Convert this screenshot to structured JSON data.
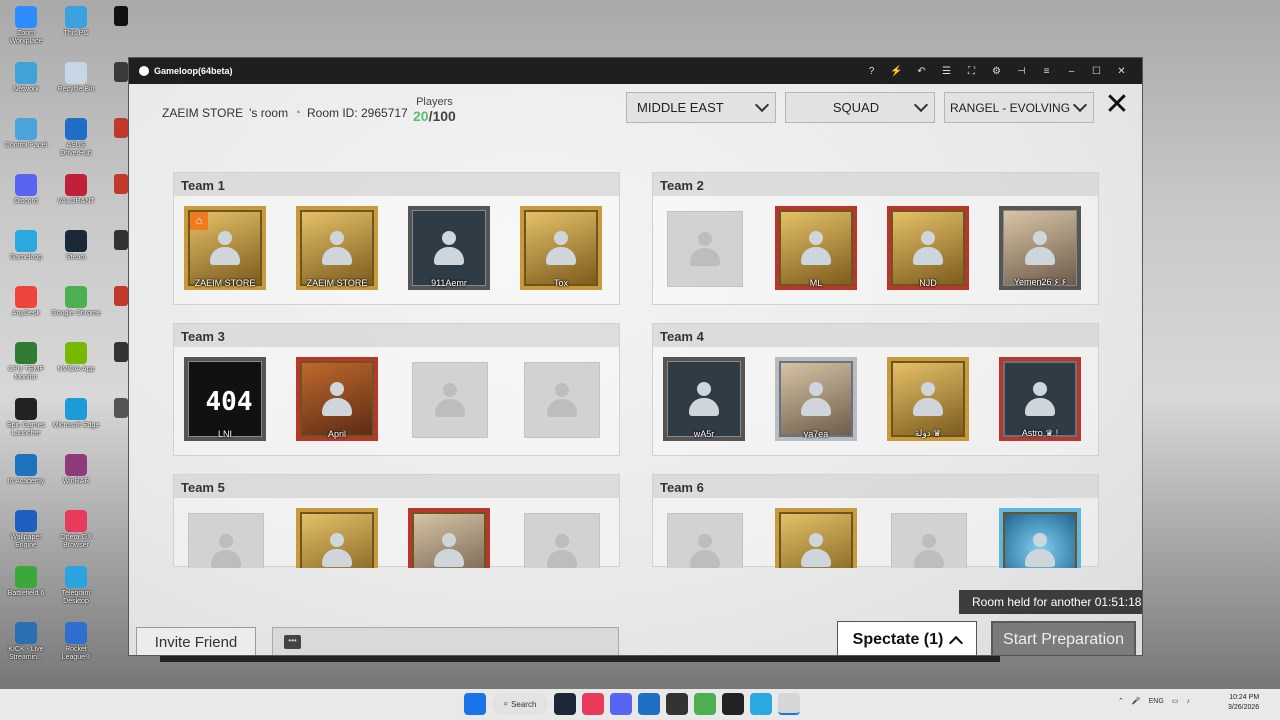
{
  "desktop": {
    "icons": [
      {
        "label": "Zoom Workplace",
        "color": "#2d8cff"
      },
      {
        "label": "This PC",
        "color": "#3aa0e0"
      },
      {
        "label": "Network",
        "color": "#3fa3d8"
      },
      {
        "label": "Recycle Bin",
        "color": "#c6d6e4"
      },
      {
        "label": "Control Panel",
        "color": "#4aa3db"
      },
      {
        "label": "ASUS DriverHub",
        "color": "#1f6fc6"
      },
      {
        "label": "Discord",
        "color": "#5865f2"
      },
      {
        "label": "VALORANT",
        "color": "#c0203a"
      },
      {
        "label": "Gameloop",
        "color": "#29a9e0"
      },
      {
        "label": "Steam",
        "color": "#1b2838"
      },
      {
        "label": "AnyDesk",
        "color": "#ef443b"
      },
      {
        "label": "Google Chrome",
        "color": "#4caf50"
      },
      {
        "label": "CPU TEMP Monitor",
        "color": "#2f7d32"
      },
      {
        "label": "NVIDIA App",
        "color": "#76b900"
      },
      {
        "label": "Epic Games Launcher",
        "color": "#222222"
      },
      {
        "label": "Microsoft Edge",
        "color": "#1d9bd8"
      },
      {
        "label": "Io Academy",
        "color": "#1e73be"
      },
      {
        "label": "WinRAR",
        "color": "#8e3b7c"
      },
      {
        "label": "Wallpaper Engine",
        "color": "#1f5fbf"
      },
      {
        "label": "Opera GX Browser",
        "color": "#e83a5b"
      },
      {
        "label": "Battlefield 6",
        "color": "#3ba83b"
      },
      {
        "label": "Telegram Desktop",
        "color": "#2aa3e0"
      },
      {
        "label": "KICK - Live Streamin...",
        "color": "#2b6fb5"
      },
      {
        "label": "Rocket League®",
        "color": "#2f6fd1"
      }
    ]
  },
  "window": {
    "title": "Gameloop(64beta)",
    "controls": [
      "?",
      "⚡",
      "↶",
      "☰",
      "⛶",
      "⚙",
      "⊣",
      "≡",
      "–",
      "☐",
      "✕"
    ]
  },
  "room": {
    "owner": "ZAEIM STORE",
    "owner_suffix": "'s room",
    "room_id": "Room ID: 2965717",
    "players_label": "Players",
    "players_current": "20",
    "players_max": "/100"
  },
  "filters": {
    "region": "MIDDLE EAST",
    "mode": "SQUAD",
    "map": "RANGEL - EVOLVING"
  },
  "teams": [
    {
      "name": "Team 1",
      "slots": [
        {
          "filled": true,
          "player": "ZAEIM STORE",
          "style": "gold",
          "home": true
        },
        {
          "filled": true,
          "player": "ZAEIM STORE",
          "style": "gold"
        },
        {
          "filled": true,
          "player": "911Aemr",
          "style": "plain"
        },
        {
          "filled": true,
          "player": "Tox",
          "style": "gold photo"
        }
      ]
    },
    {
      "name": "Team 2",
      "slots": [
        {
          "filled": false
        },
        {
          "filled": true,
          "player": "ML",
          "style": "gold red"
        },
        {
          "filled": true,
          "player": "NJD",
          "style": "gold red"
        },
        {
          "filled": true,
          "player": "Yemen26 ۶ ۶",
          "style": "plain photo"
        }
      ]
    },
    {
      "name": "Team 3",
      "slots": [
        {
          "filled": true,
          "player": "LNI",
          "style": "plain dark",
          "big": "404"
        },
        {
          "filled": true,
          "player": "April",
          "style": "red orange"
        },
        {
          "filled": false
        },
        {
          "filled": false
        }
      ]
    },
    {
      "name": "Team 4",
      "slots": [
        {
          "filled": true,
          "player": "wA5r",
          "style": "plain"
        },
        {
          "filled": true,
          "player": "ya7ea",
          "style": "silver photo"
        },
        {
          "filled": true,
          "player": "دولة ♛",
          "style": "gold photo"
        },
        {
          "filled": true,
          "player": "Astro ♛ !",
          "style": "silver red"
        }
      ]
    },
    {
      "name": "Team 5",
      "slots": [
        {
          "filled": false
        },
        {
          "filled": true,
          "player": "",
          "style": "gold"
        },
        {
          "filled": true,
          "player": "",
          "style": "red photo"
        },
        {
          "filled": false
        }
      ]
    },
    {
      "name": "Team 6",
      "slots": [
        {
          "filled": false
        },
        {
          "filled": true,
          "player": "",
          "style": "gold gold"
        },
        {
          "filled": false
        },
        {
          "filled": true,
          "player": "",
          "style": "blue"
        }
      ]
    }
  ],
  "footer": {
    "invite_label": "Invite Friend",
    "room_held_text": "Room held for another 01:51:18",
    "spectate_label": "Spectate (1)",
    "start_label": "Start Preparation"
  },
  "taskbar": {
    "search_label": "Search",
    "language": "ENG",
    "time": "10:24 PM",
    "date": "3/26/2026"
  }
}
